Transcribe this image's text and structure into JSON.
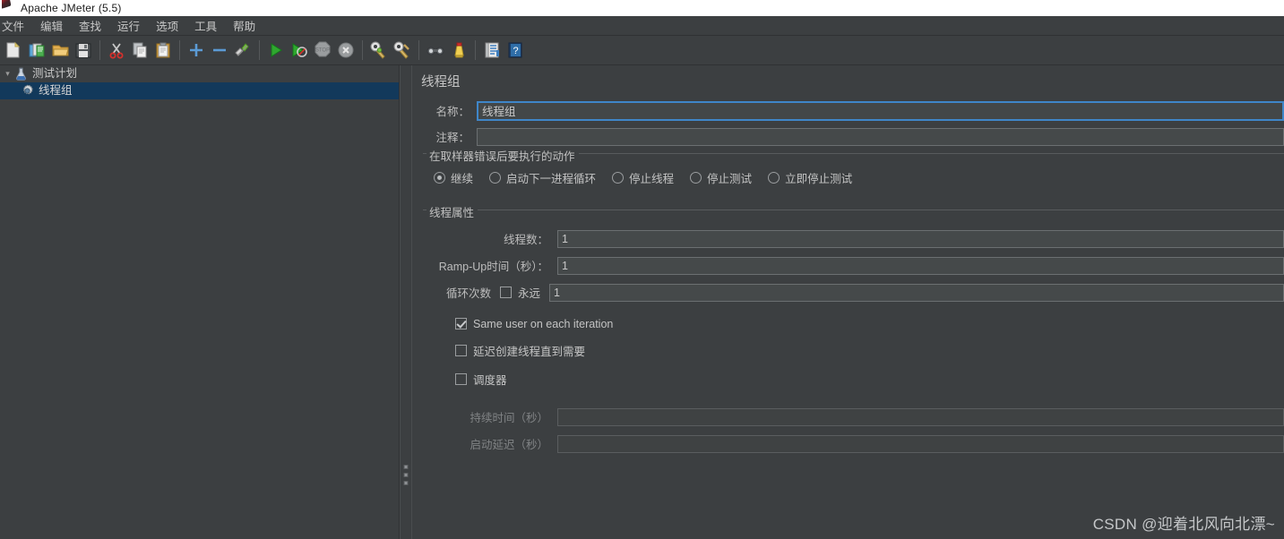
{
  "window": {
    "title": "Apache JMeter (5.5)",
    "app_icon": "jmeter-feather-icon"
  },
  "menubar": {
    "items": [
      {
        "label": "文件",
        "name": "menu-file"
      },
      {
        "label": "编辑",
        "name": "menu-edit"
      },
      {
        "label": "查找",
        "name": "menu-search"
      },
      {
        "label": "运行",
        "name": "menu-run"
      },
      {
        "label": "选项",
        "name": "menu-options"
      },
      {
        "label": "工具",
        "name": "menu-tools"
      },
      {
        "label": "帮助",
        "name": "menu-help"
      }
    ]
  },
  "toolbar": {
    "buttons": [
      {
        "name": "new-icon",
        "title": "新建"
      },
      {
        "name": "templates-icon",
        "title": "模板"
      },
      {
        "name": "open-icon",
        "title": "打开"
      },
      {
        "name": "save-icon",
        "title": "保存"
      },
      {
        "name": "cut-icon",
        "title": "剪切"
      },
      {
        "name": "copy-icon",
        "title": "复制"
      },
      {
        "name": "paste-icon",
        "title": "粘贴"
      },
      {
        "name": "expand-all-icon",
        "title": "展开"
      },
      {
        "name": "collapse-all-icon",
        "title": "收起"
      },
      {
        "name": "toggle-icon",
        "title": "启用/禁用"
      },
      {
        "name": "start-icon",
        "title": "启动"
      },
      {
        "name": "start-no-pauses-icon",
        "title": "无停顿启动"
      },
      {
        "name": "stop-icon",
        "title": "停止"
      },
      {
        "name": "shutdown-icon",
        "title": "关闭"
      },
      {
        "name": "clear-icon",
        "title": "清除"
      },
      {
        "name": "clear-all-icon",
        "title": "清除全部"
      },
      {
        "name": "search-icon",
        "title": "搜索"
      },
      {
        "name": "reset-search-icon",
        "title": "重置搜索"
      },
      {
        "name": "function-helper-icon",
        "title": "函数助手"
      },
      {
        "name": "help-icon",
        "title": "帮助"
      }
    ]
  },
  "tree": {
    "nodes": [
      {
        "label": "测试计划",
        "icon": "test-plan-icon",
        "selected": false,
        "level": 0
      },
      {
        "label": "线程组",
        "icon": "thread-group-icon",
        "selected": true,
        "level": 1
      }
    ]
  },
  "editor": {
    "panel_title": "线程组",
    "name_label": "名称：",
    "name_value": "线程组",
    "comment_label": "注释：",
    "comment_value": "",
    "on_error": {
      "title": "在取样器错误后要执行的动作",
      "options": [
        {
          "label": "继续",
          "checked": true
        },
        {
          "label": "启动下一进程循环",
          "checked": false
        },
        {
          "label": "停止线程",
          "checked": false
        },
        {
          "label": "停止测试",
          "checked": false
        },
        {
          "label": "立即停止测试",
          "checked": false
        }
      ]
    },
    "thread_properties": {
      "title": "线程属性",
      "num_threads_label": "线程数：",
      "num_threads_value": "1",
      "ramp_up_label": "Ramp-Up时间（秒）：",
      "ramp_up_value": "1",
      "loop_count_label": "循环次数",
      "forever_label": "永远",
      "forever_checked": false,
      "loop_count_value": "1",
      "same_user_label": "Same user on each iteration",
      "same_user_checked": true,
      "delayed_start_label": "延迟创建线程直到需要",
      "delayed_start_checked": false,
      "scheduler_label": "调度器",
      "scheduler_checked": false,
      "duration_label": "持续时间（秒）",
      "duration_value": "",
      "duration_disabled": true,
      "startup_delay_label": "启动延迟（秒）",
      "startup_delay_value": "",
      "startup_delay_disabled": true
    }
  },
  "watermark": {
    "text": "CSDN @迎着北风向北漂~"
  },
  "colors": {
    "window_bg": "#3c3f41",
    "titlebar_bg": "#ffffff",
    "selection_bg": "#12395b",
    "focus_border": "#3f86c9",
    "input_bg": "#45494a",
    "text": "#c4c4c4"
  }
}
